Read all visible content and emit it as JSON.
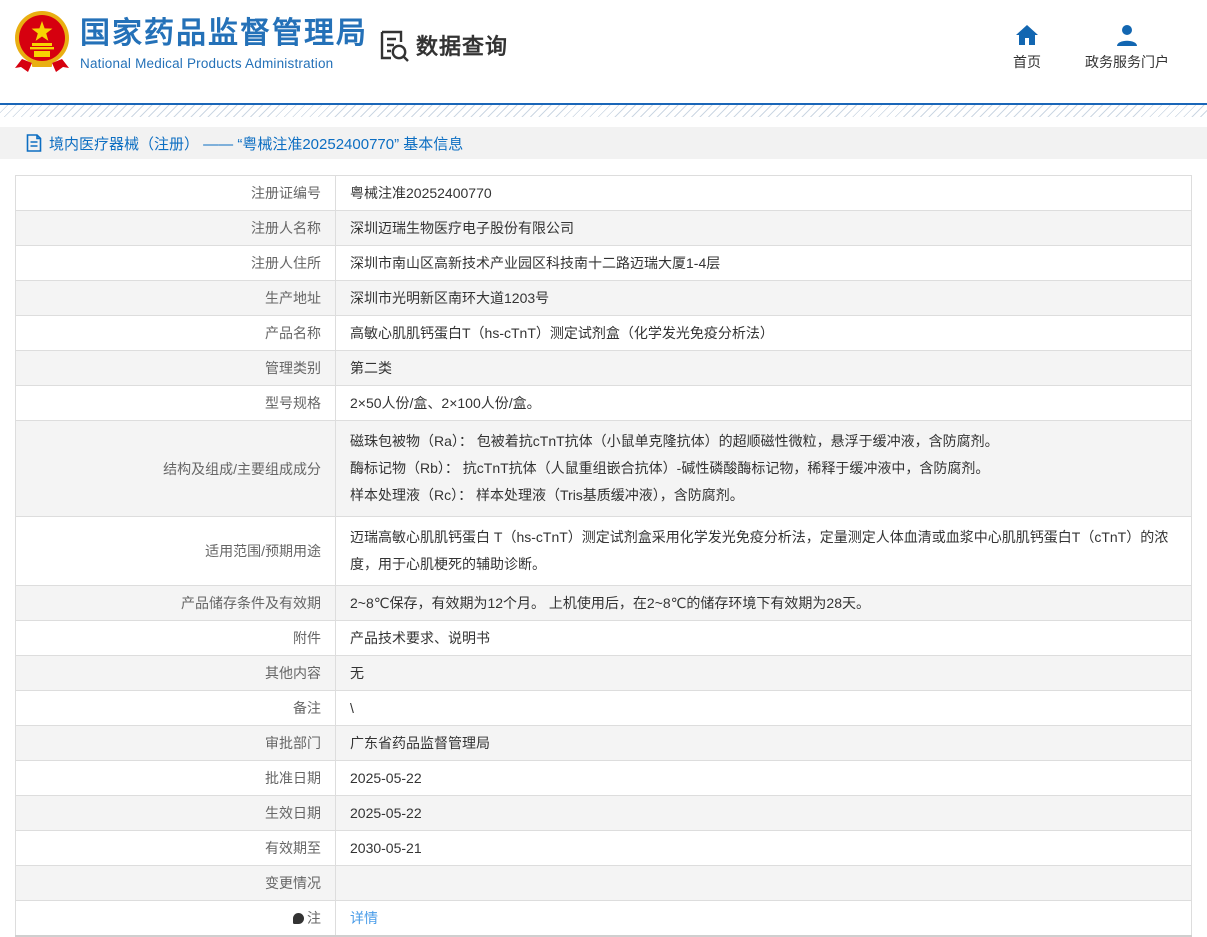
{
  "header": {
    "site_title": "国家药品监督管理局",
    "site_subtitle": "National Medical Products Administration",
    "query_label": "数据查询",
    "nav": {
      "home_label": "首页",
      "portal_label": "政务服务门户"
    }
  },
  "breadcrumb": {
    "text": "境内医疗器械（注册） —— “粤械注准20252400770” 基本信息"
  },
  "table": {
    "rows": [
      {
        "label": "注册证编号",
        "value": "粤械注准20252400770"
      },
      {
        "label": "注册人名称",
        "value": "深圳迈瑞生物医疗电子股份有限公司"
      },
      {
        "label": "注册人住所",
        "value": "深圳市南山区高新技术产业园区科技南十二路迈瑞大厦1-4层"
      },
      {
        "label": "生产地址",
        "value": "深圳市光明新区南环大道1203号"
      },
      {
        "label": "产品名称",
        "value": "高敏心肌肌钙蛋白T（hs-cTnT）测定试剂盒（化学发光免疫分析法）"
      },
      {
        "label": "管理类别",
        "value": "第二类"
      },
      {
        "label": "型号规格",
        "value": "2×50人份/盒、2×100人份/盒。"
      },
      {
        "label": "结构及组成/主要组成成分",
        "lines": [
          "磁珠包被物（Ra）： 包被着抗cTnT抗体（小鼠单克隆抗体）的超顺磁性微粒，悬浮于缓冲液，含防腐剂。",
          "酶标记物（Rb）： 抗cTnT抗体（人鼠重组嵌合抗体）-碱性磷酸酶标记物，稀释于缓冲液中，含防腐剂。",
          "样本处理液（Rc）： 样本处理液（Tris基质缓冲液），含防腐剂。"
        ]
      },
      {
        "label": "适用范围/预期用途",
        "paragraph": "迈瑞高敏心肌肌钙蛋白 T（hs-cTnT）测定试剂盒采用化学发光免疫分析法，定量测定人体血清或血浆中心肌肌钙蛋白T（cTnT）的浓度，用于心肌梗死的辅助诊断。"
      },
      {
        "label": "产品储存条件及有效期",
        "value": "2~8℃保存，有效期为12个月。 上机使用后，在2~8℃的储存环境下有效期为28天。"
      },
      {
        "label": "附件",
        "value": "产品技术要求、说明书"
      },
      {
        "label": "其他内容",
        "value": "无"
      },
      {
        "label": "备注",
        "value": "\\"
      },
      {
        "label": "审批部门",
        "value": "广东省药品监督管理局"
      },
      {
        "label": "批准日期",
        "value": "2025-05-22"
      },
      {
        "label": "生效日期",
        "value": "2025-05-22"
      },
      {
        "label": "有效期至",
        "value": "2030-05-21"
      },
      {
        "label": "变更情况",
        "value": ""
      },
      {
        "label": "注",
        "label_icon": "bulb-icon",
        "link": "详情"
      }
    ]
  },
  "colors": {
    "title_blue": "#2471b8",
    "breadcrumb_blue": "#0c6ec2",
    "divider_blue": "#1a66b8",
    "nav_icon_blue": "#1266b1",
    "link_blue": "#4a9ce8",
    "row_alt_gray": "#f4f4f4",
    "band_gray": "#f2f2f2"
  }
}
